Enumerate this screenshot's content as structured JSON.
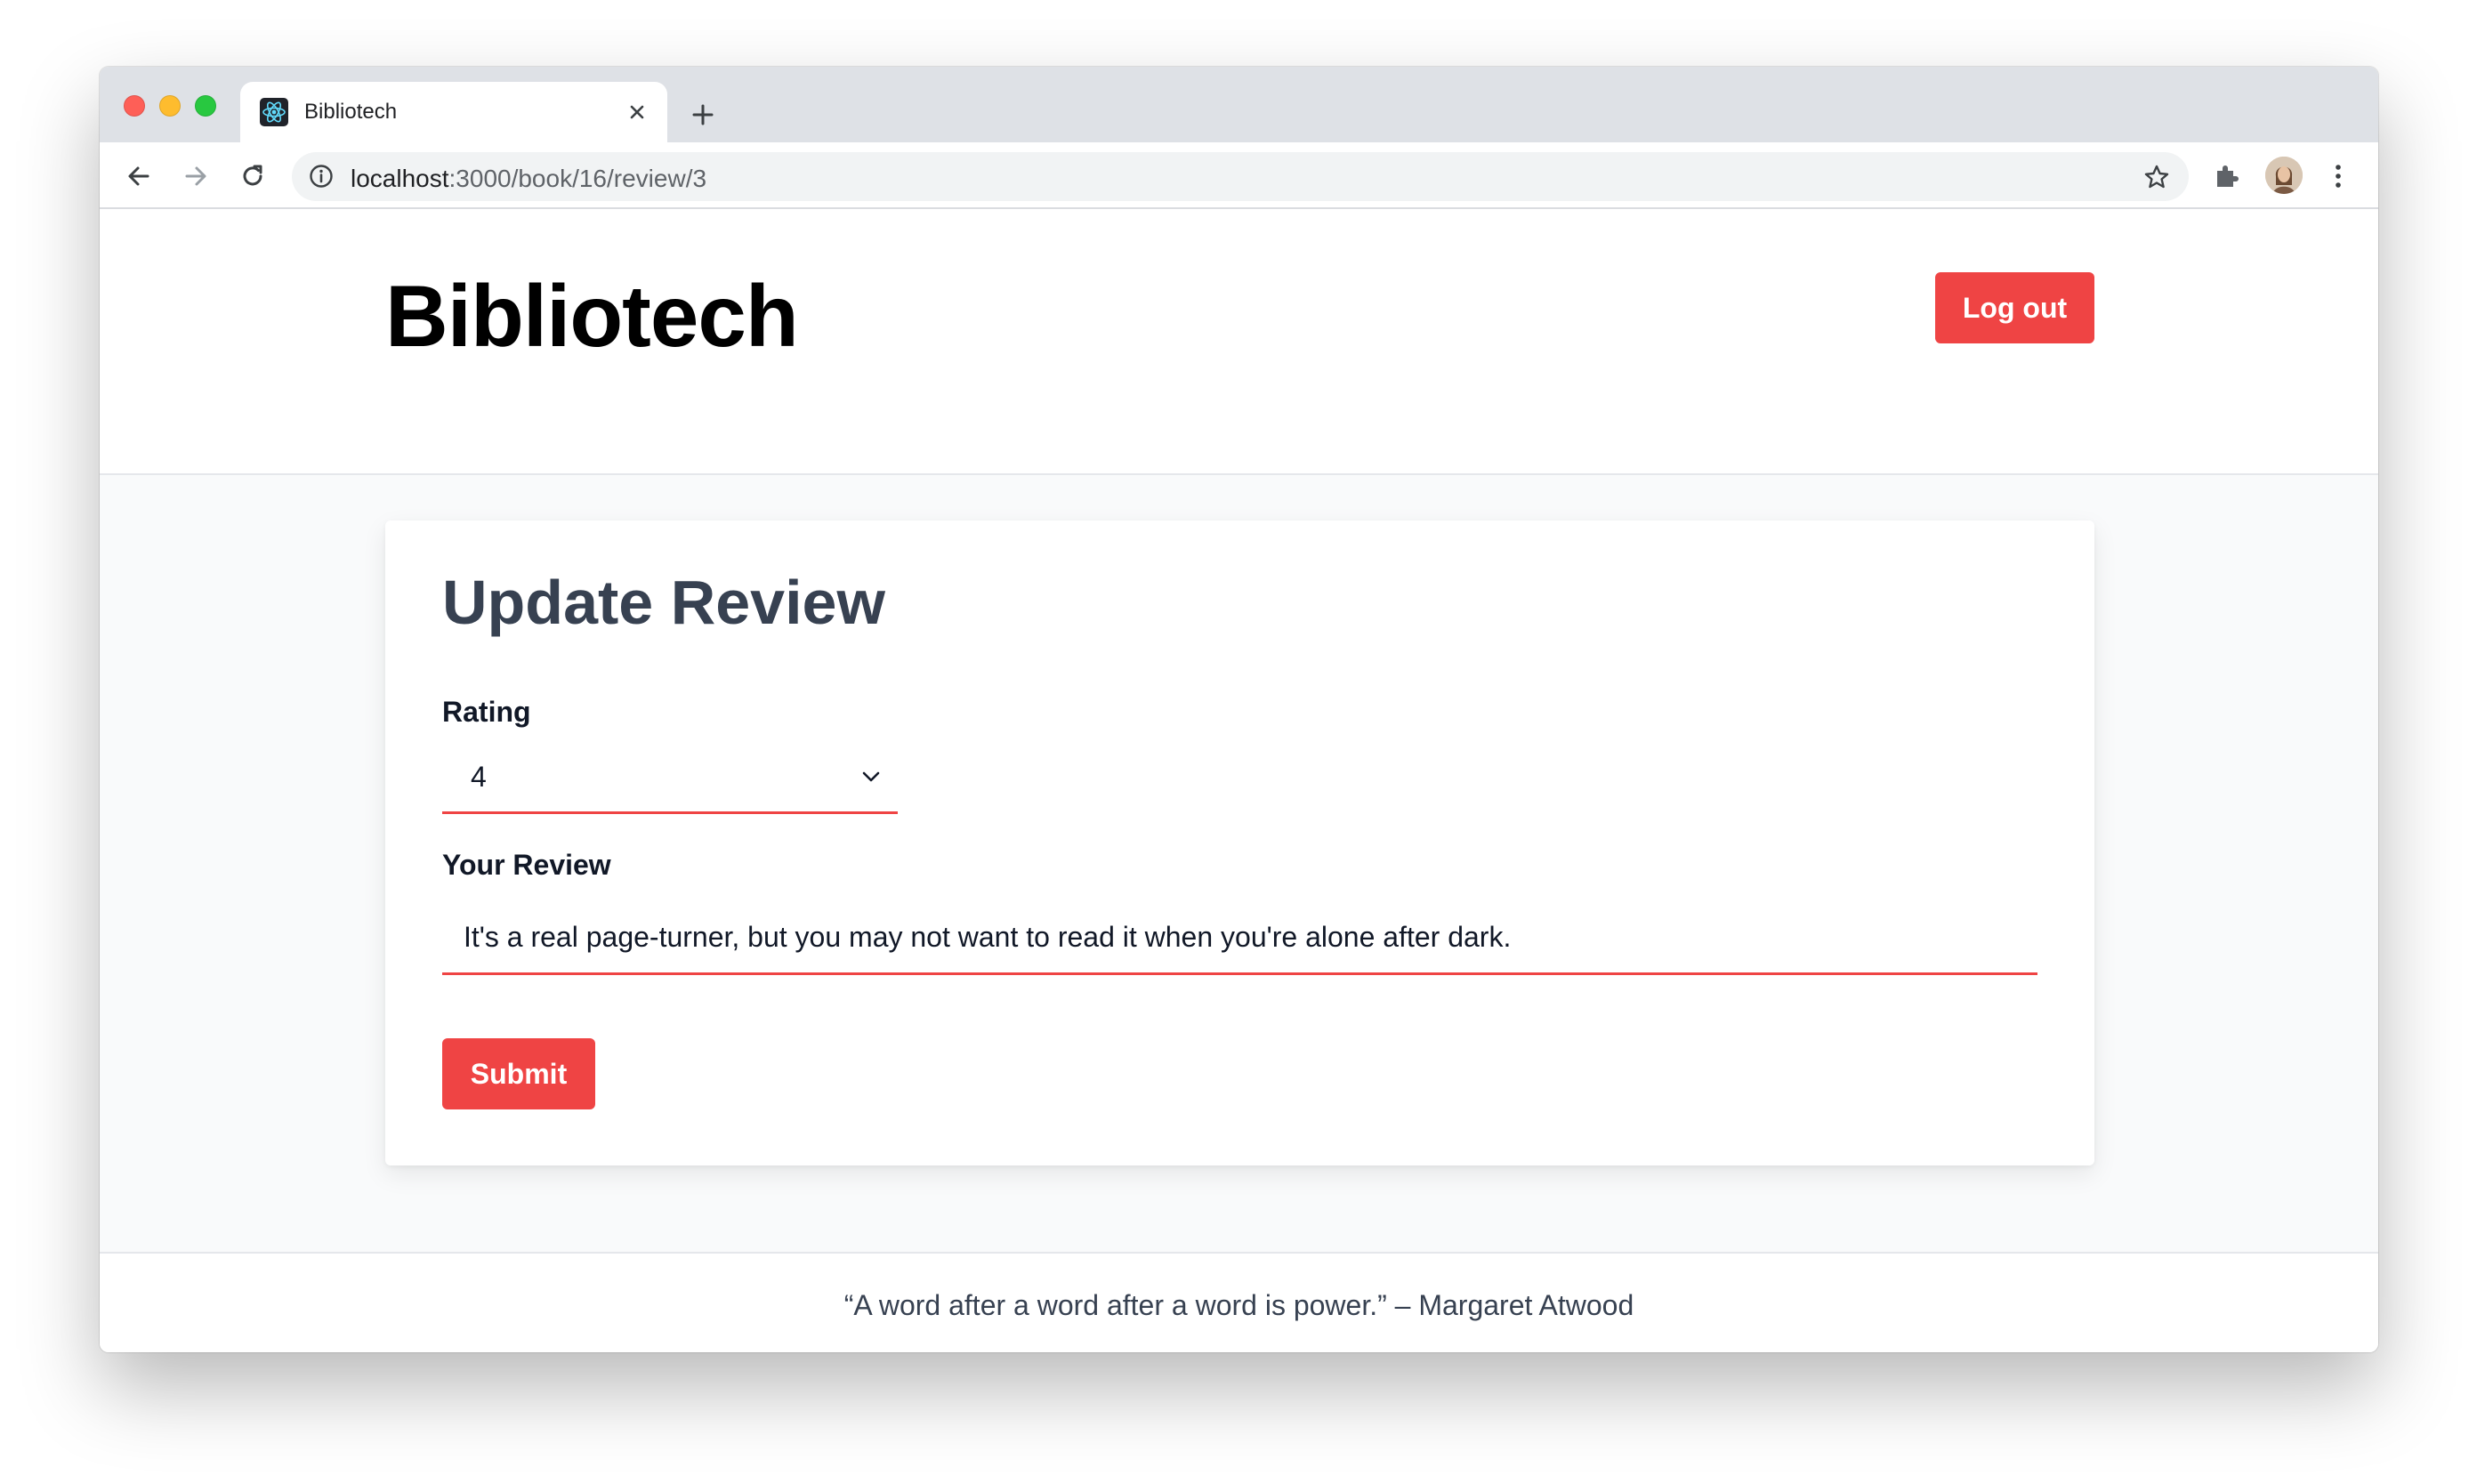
{
  "browser": {
    "tab": {
      "title": "Bibliotech",
      "favicon": "react-icon"
    },
    "address_bar": {
      "host": "localhost",
      "path": ":3000/book/16/review/3"
    }
  },
  "header": {
    "brand": "Bibliotech",
    "logout_label": "Log out"
  },
  "form": {
    "title": "Update Review",
    "rating_label": "Rating",
    "rating_value": "4",
    "review_label": "Your Review",
    "review_value": "It's a real page-turner, but you may not want to read it when you're alone after dark.",
    "submit_label": "Submit"
  },
  "footer": {
    "quote": "“A word after a word after a word is power.” – Margaret Atwood"
  },
  "colors": {
    "accent": "#ef4444",
    "heading": "#374151",
    "page_bg": "#f9fafb"
  }
}
